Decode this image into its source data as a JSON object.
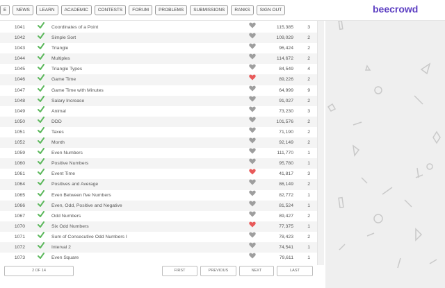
{
  "nav": {
    "items": [
      "E",
      "NEWS",
      "LEARN",
      "ACADEMIC",
      "CONTESTS",
      "FORUM",
      "PROBLEMS",
      "SUBMISSIONS",
      "RANKS",
      "SIGN OUT"
    ]
  },
  "brand": {
    "logo": "beecrowd"
  },
  "colors": {
    "brand": "#5c3ec2",
    "check": "#5cb85c",
    "fav_active": "#e85a5a",
    "fav_inactive": "#9e9e9e"
  },
  "problems": [
    {
      "id": "1041",
      "name": "Coordinates of a Point",
      "fav": false,
      "solved": "115,385",
      "level": "3"
    },
    {
      "id": "1042",
      "name": "Simple Sort",
      "fav": false,
      "solved": "109,029",
      "level": "2"
    },
    {
      "id": "1043",
      "name": "Triangle",
      "fav": false,
      "solved": "96,424",
      "level": "2"
    },
    {
      "id": "1044",
      "name": "Multiples",
      "fav": false,
      "solved": "114,672",
      "level": "2"
    },
    {
      "id": "1045",
      "name": "Triangle Types",
      "fav": false,
      "solved": "84,549",
      "level": "4"
    },
    {
      "id": "1046",
      "name": "Game Time",
      "fav": true,
      "solved": "89,226",
      "level": "2"
    },
    {
      "id": "1047",
      "name": "Game Time with Minutes",
      "fav": false,
      "solved": "64,999",
      "level": "9"
    },
    {
      "id": "1048",
      "name": "Salary Increase",
      "fav": false,
      "solved": "91,027",
      "level": "2"
    },
    {
      "id": "1049",
      "name": "Animal",
      "fav": false,
      "solved": "73,230",
      "level": "3"
    },
    {
      "id": "1050",
      "name": "DDD",
      "fav": false,
      "solved": "101,576",
      "level": "2"
    },
    {
      "id": "1051",
      "name": "Taxes",
      "fav": false,
      "solved": "71,190",
      "level": "2"
    },
    {
      "id": "1052",
      "name": "Month",
      "fav": false,
      "solved": "92,149",
      "level": "2"
    },
    {
      "id": "1059",
      "name": "Even Numbers",
      "fav": false,
      "solved": "111,770",
      "level": "1"
    },
    {
      "id": "1060",
      "name": "Positive Numbers",
      "fav": false,
      "solved": "95,780",
      "level": "1"
    },
    {
      "id": "1061",
      "name": "Event Time",
      "fav": true,
      "solved": "41,817",
      "level": "3"
    },
    {
      "id": "1064",
      "name": "Positives and Average",
      "fav": false,
      "solved": "86,149",
      "level": "2"
    },
    {
      "id": "1065",
      "name": "Even Between five Numbers",
      "fav": false,
      "solved": "82,772",
      "level": "1"
    },
    {
      "id": "1066",
      "name": "Even, Odd, Positive and Negative",
      "fav": false,
      "solved": "81,524",
      "level": "1"
    },
    {
      "id": "1067",
      "name": "Odd Numbers",
      "fav": false,
      "solved": "89,427",
      "level": "2"
    },
    {
      "id": "1070",
      "name": "Six Odd Numbers",
      "fav": true,
      "solved": "77,375",
      "level": "1"
    },
    {
      "id": "1071",
      "name": "Sum of Consecutive Odd Numbers I",
      "fav": false,
      "solved": "78,423",
      "level": "2"
    },
    {
      "id": "1072",
      "name": "Interval 2",
      "fav": false,
      "solved": "74,541",
      "level": "1"
    },
    {
      "id": "1073",
      "name": "Even Square",
      "fav": false,
      "solved": "79,611",
      "level": "1"
    }
  ],
  "pagination": {
    "info": "2 OF 14",
    "first": "FIRST",
    "previous": "PREVIOUS",
    "next": "NEXT",
    "last": "LAST"
  },
  "icons": {
    "check": "check-icon",
    "favorite": "heart-icon"
  }
}
